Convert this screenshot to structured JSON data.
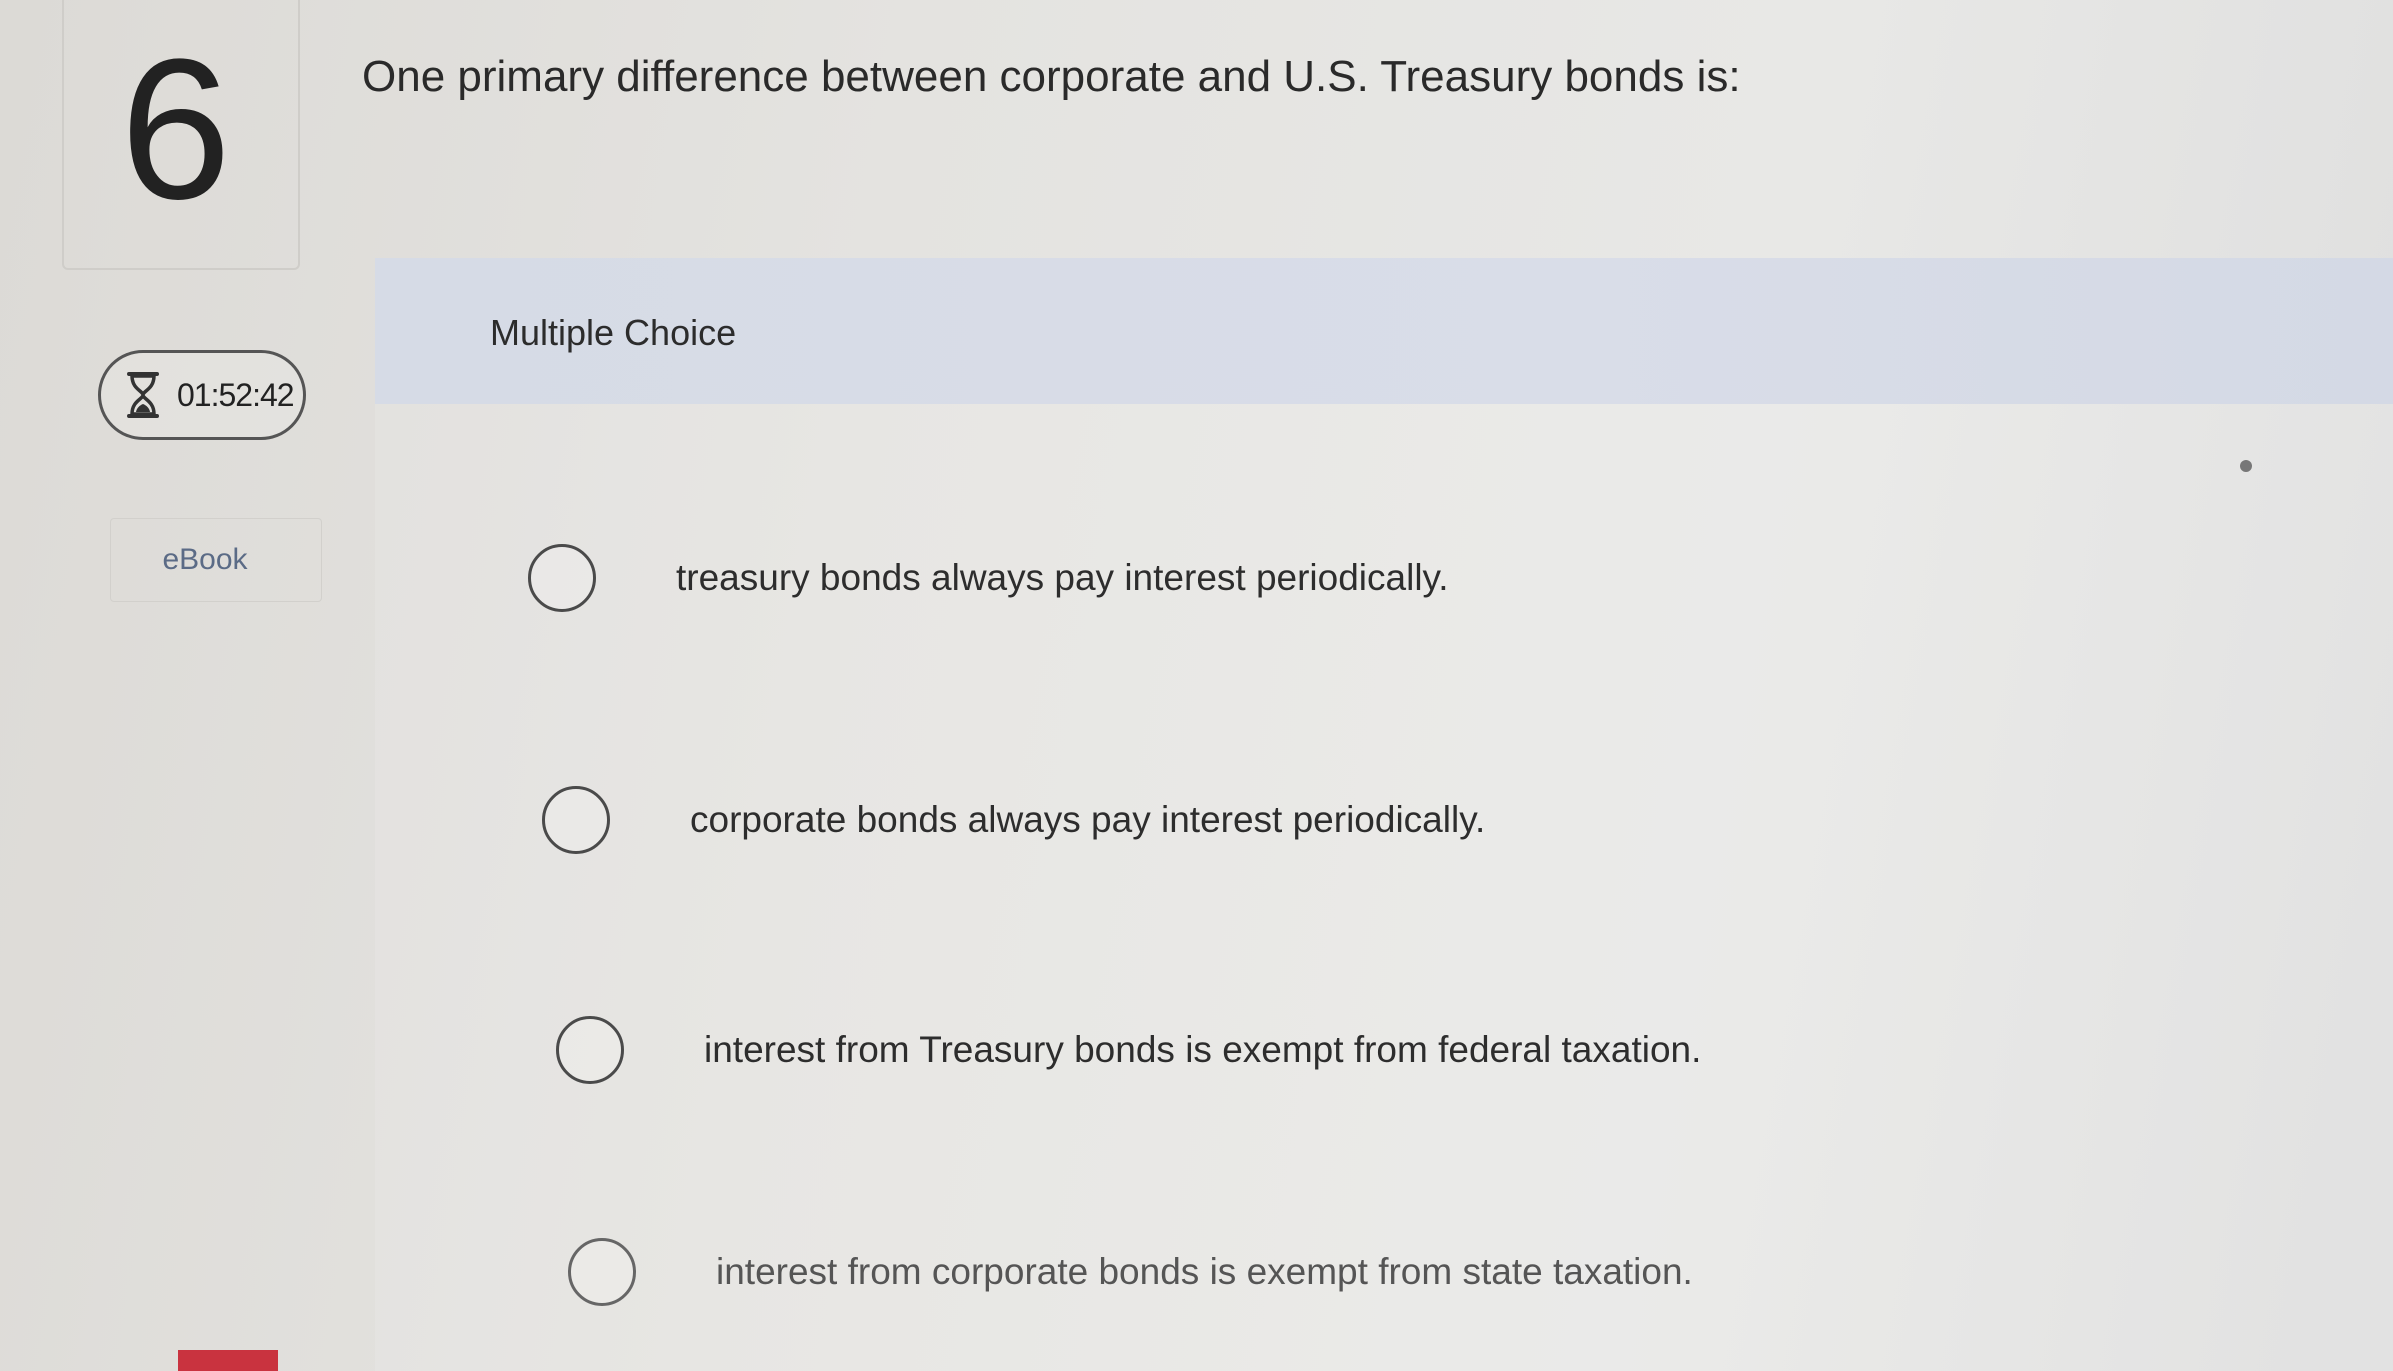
{
  "question": {
    "number": "6",
    "text": "One primary difference between corporate and U.S. Treasury bonds is:"
  },
  "sidebar": {
    "timer": {
      "icon": "hourglass-icon",
      "value": "01:52:42"
    },
    "ebook_label": "eBook"
  },
  "answer_panel": {
    "type_label": "Multiple Choice",
    "options": [
      {
        "label": "treasury bonds always pay interest periodically."
      },
      {
        "label": "corporate bonds always pay interest periodically."
      },
      {
        "label": "interest from Treasury bonds is exempt from federal taxation."
      },
      {
        "label": "interest from corporate bonds is exempt from state taxation."
      }
    ]
  },
  "colors": {
    "header_band": "#d6dbe6",
    "ebook_text": "#5b6b86",
    "red_tab": "#c9333f"
  }
}
